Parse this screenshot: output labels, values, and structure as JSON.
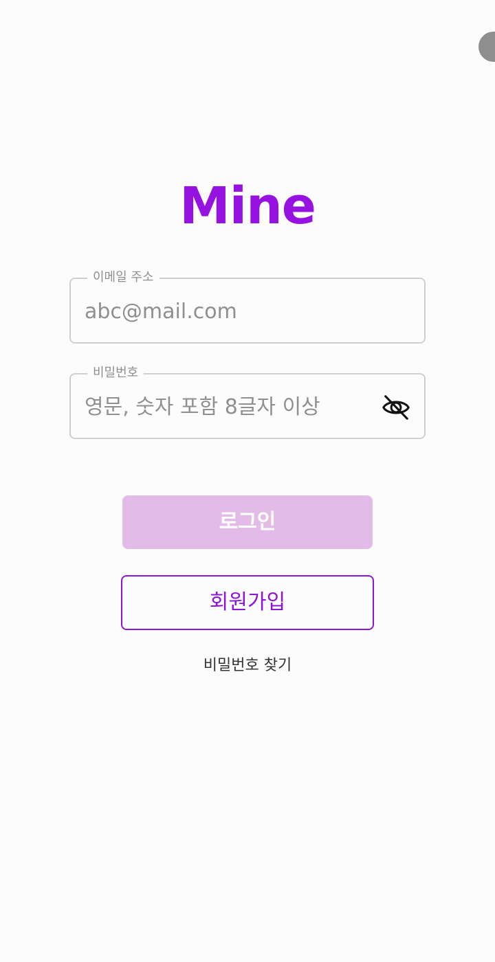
{
  "app": {
    "logo_text": "Mine",
    "accent_color": "#9512E0"
  },
  "login_form": {
    "email": {
      "label": "이메일 주소",
      "placeholder": "abc@mail.com",
      "value": ""
    },
    "password": {
      "label": "비밀번호",
      "placeholder": "영문, 숫자 포함 8글자 이상",
      "value": "",
      "visibility_icon": "eye-off-icon"
    },
    "login_button_label": "로그인",
    "login_button_color": "#E2BCE6",
    "signup_button_label": "회원가입",
    "find_password_label": "비밀번호 찾기"
  }
}
